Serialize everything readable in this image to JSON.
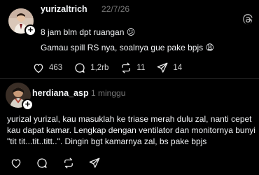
{
  "post1": {
    "username": "yurizaltrich",
    "timestamp": "22/7/26",
    "lines": [
      "8 jam blm dpt ruangan 😕",
      "Gamau spill RS nya, soalnya gue pake bpjs 😩"
    ],
    "likes": "463",
    "comments": "1,2rb",
    "reposts": "11",
    "shares": "14"
  },
  "post2": {
    "username": "herdiana_asp",
    "timestamp": "1 minggu",
    "body": "yurizal yurizal, kau masuklah ke triase merah dulu zal, nanti cepet kau dapat kamar. Lengkap dengan ventilator dan monitornya bunyi \"tit tit...tit..titt..\". Dingin bgt kamarnya zal, bs pake bpjs"
  },
  "icons": {
    "logo": "threads-logo-icon",
    "like": "heart-icon",
    "comment": "comment-icon",
    "repost": "repost-icon",
    "share": "send-icon"
  },
  "colors": {
    "background": "#000000",
    "text": "#f3f5f7",
    "muted": "#777777"
  }
}
